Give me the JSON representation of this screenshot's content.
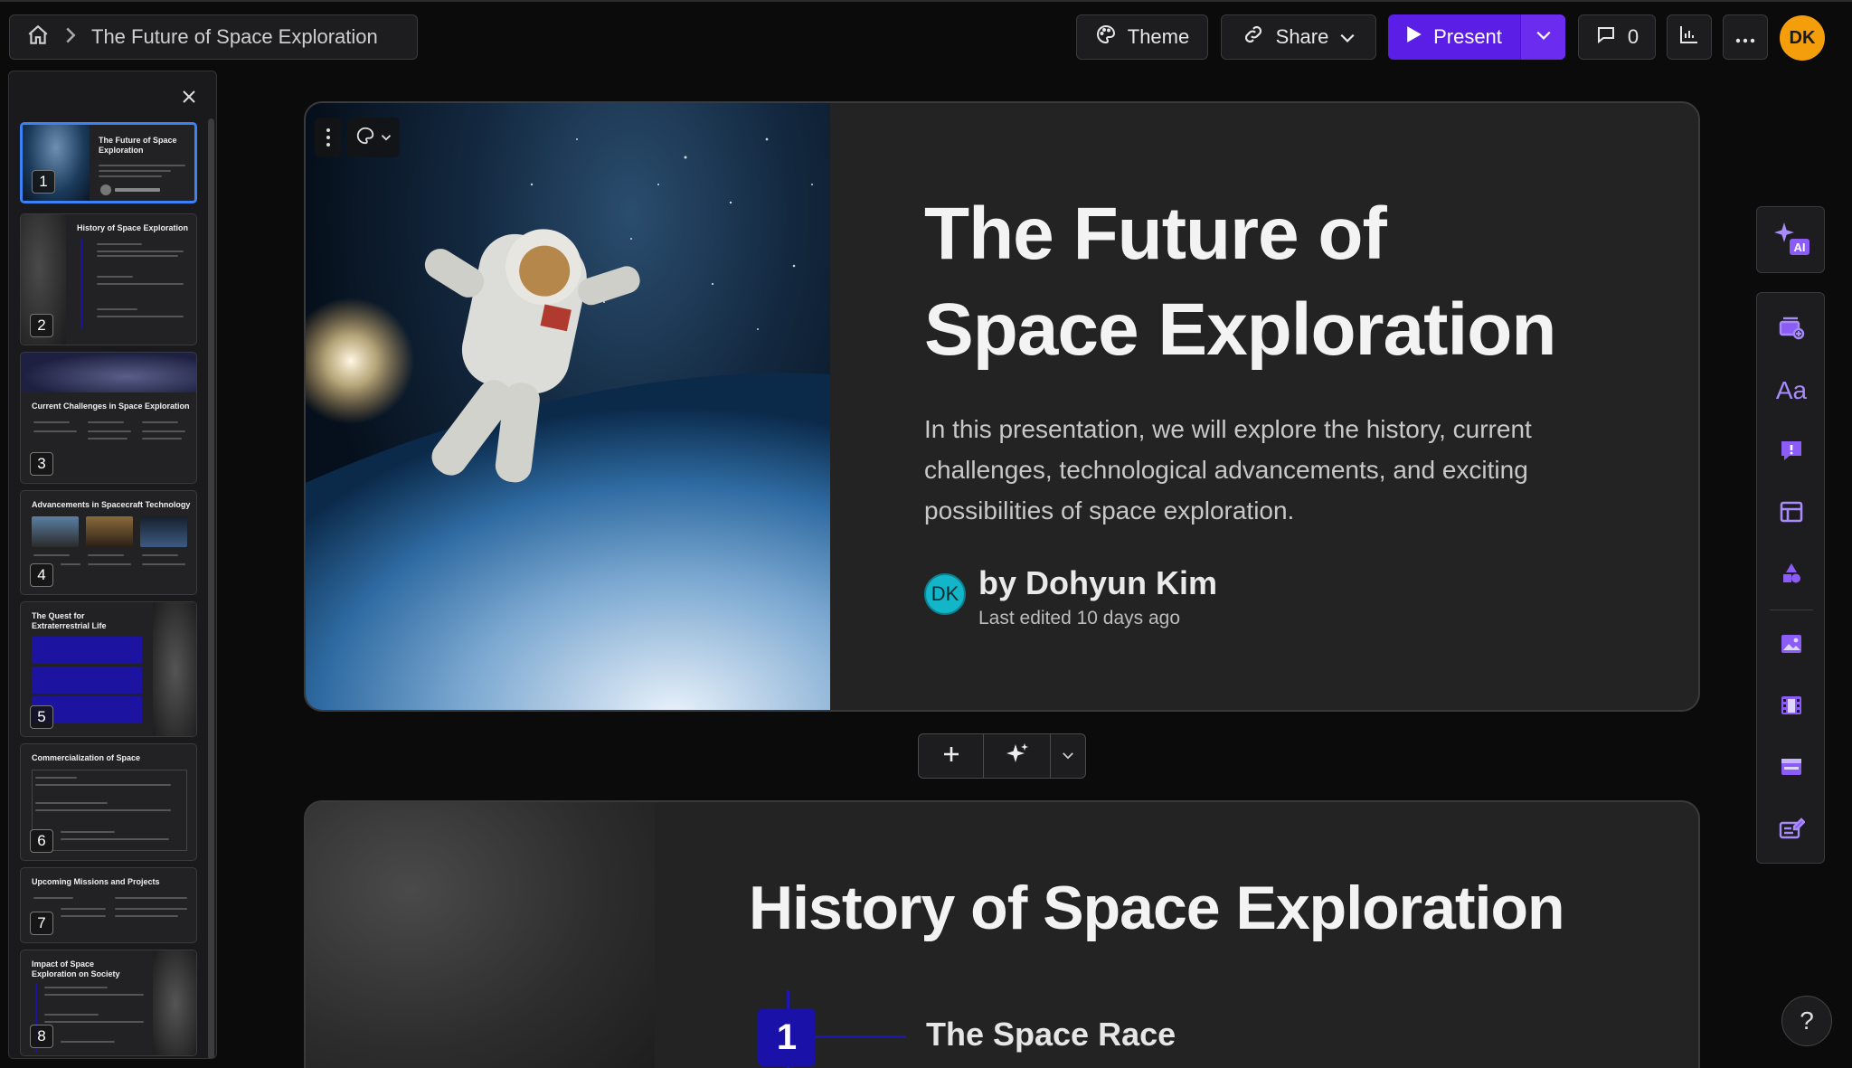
{
  "breadcrumb": {
    "title": "The Future of Space Exploration"
  },
  "toolbar": {
    "theme_label": "Theme",
    "share_label": "Share",
    "present_label": "Present",
    "comments_count": "0",
    "user_initials": "DK"
  },
  "thumbnails": [
    {
      "num": "1",
      "title": "The Future of Space Exploration"
    },
    {
      "num": "2",
      "title": "History of Space Exploration"
    },
    {
      "num": "3",
      "title": "Current Challenges in Space Exploration"
    },
    {
      "num": "4",
      "title": "Advancements in Spacecraft Technology"
    },
    {
      "num": "5",
      "title": "The Quest for Extraterrestrial Life"
    },
    {
      "num": "6",
      "title": "Commercialization of Space"
    },
    {
      "num": "7",
      "title": "Upcoming Missions and Projects"
    },
    {
      "num": "8",
      "title": "Impact of Space Exploration on Society"
    }
  ],
  "slide1": {
    "title_line1": "The Future of",
    "title_line2": "Space Exploration",
    "description": "In this presentation, we will explore the history, current challenges, technological advancements, and exciting possibilities of space exploration.",
    "author_initials": "DK",
    "author": "by Dohyun Kim",
    "last_edited": "Last edited 10 days ago"
  },
  "slide2": {
    "title": "History of Space Exploration",
    "timeline_first_num": "1",
    "timeline_first_label": "The Space Race"
  },
  "rail": {
    "ai_badge": "AI",
    "text_glyph": "Aa"
  },
  "help_label": "?",
  "colors": {
    "accent": "#5a1ee6",
    "avatar": "#f59e0b",
    "active_thumb": "#3b82f6",
    "timeline": "#1a12a8"
  }
}
